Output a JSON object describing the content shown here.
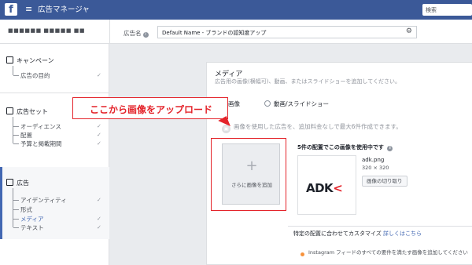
{
  "topbar": {
    "logo": "f",
    "menu_icon": "≡",
    "title": "広告マネージャ",
    "search_placeholder": "検索"
  },
  "subheader": {
    "account_name": "■■■■■■ ■■■■■ ■■",
    "adname_label": "広告名",
    "adname_value": "Default Name - ブランドの認知度アップ",
    "gear_icon": "gear-icon"
  },
  "sidebar": {
    "campaign": {
      "label": "キャンペーン",
      "items": [
        {
          "label": "広告の目的"
        }
      ]
    },
    "adset": {
      "label": "広告セット",
      "items": [
        {
          "label": "オーディエンス"
        },
        {
          "label": "配置"
        },
        {
          "label": "予算と掲載期間"
        }
      ]
    },
    "ad": {
      "label": "広告",
      "items": [
        {
          "label": "アイデンティティ"
        },
        {
          "label": "形式"
        },
        {
          "label": "メディア"
        },
        {
          "label": "テキスト"
        }
      ]
    },
    "check": "✓"
  },
  "media": {
    "title": "メディア",
    "description": "広告用の画像(横幅可)、動画、またはスライドショーを追加してください。",
    "option_image": "画像",
    "option_video": "動画/スライドショー",
    "info": "画像を使用した広告を、追加料金なしで最大6件作成できます。",
    "add_image": "さらに画像を追加",
    "plus": "+",
    "placement_heading": "5件の配置でこの画像を使用中です",
    "thumb_logo": "ADK",
    "thumb_arrow": "<",
    "file_name": "adk.png",
    "file_dims": "320 × 320",
    "crop_button": "画像の切り取り",
    "customize_text": "特定の配置に合わせてカスタマイズ",
    "customize_link": "詳しくはこちら",
    "warning": "Instagram フィードのすべての要件を満たす画像を追加してください"
  },
  "callout": {
    "text": "ここから画像をアップロード"
  },
  "colors": {
    "brand": "#3b5998",
    "accent": "#4267b2",
    "callout": "#e4242b"
  }
}
